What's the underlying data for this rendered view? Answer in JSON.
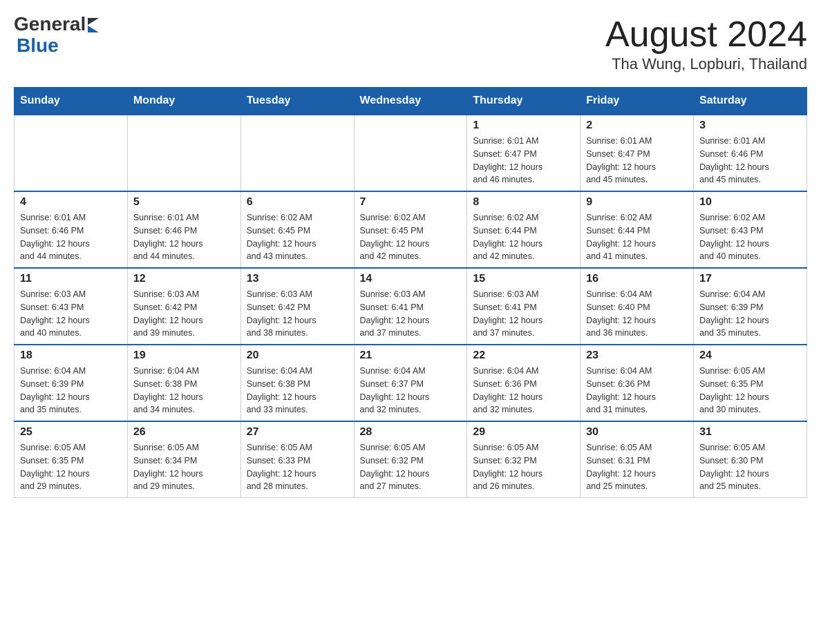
{
  "header": {
    "logo": {
      "general": "General",
      "arrow": "▶",
      "blue": "Blue"
    },
    "title": "August 2024",
    "subtitle": "Tha Wung, Lopburi, Thailand"
  },
  "weekdays": [
    "Sunday",
    "Monday",
    "Tuesday",
    "Wednesday",
    "Thursday",
    "Friday",
    "Saturday"
  ],
  "weeks": [
    [
      {
        "day": "",
        "info": ""
      },
      {
        "day": "",
        "info": ""
      },
      {
        "day": "",
        "info": ""
      },
      {
        "day": "",
        "info": ""
      },
      {
        "day": "1",
        "info": "Sunrise: 6:01 AM\nSunset: 6:47 PM\nDaylight: 12 hours\nand 46 minutes."
      },
      {
        "day": "2",
        "info": "Sunrise: 6:01 AM\nSunset: 6:47 PM\nDaylight: 12 hours\nand 45 minutes."
      },
      {
        "day": "3",
        "info": "Sunrise: 6:01 AM\nSunset: 6:46 PM\nDaylight: 12 hours\nand 45 minutes."
      }
    ],
    [
      {
        "day": "4",
        "info": "Sunrise: 6:01 AM\nSunset: 6:46 PM\nDaylight: 12 hours\nand 44 minutes."
      },
      {
        "day": "5",
        "info": "Sunrise: 6:01 AM\nSunset: 6:46 PM\nDaylight: 12 hours\nand 44 minutes."
      },
      {
        "day": "6",
        "info": "Sunrise: 6:02 AM\nSunset: 6:45 PM\nDaylight: 12 hours\nand 43 minutes."
      },
      {
        "day": "7",
        "info": "Sunrise: 6:02 AM\nSunset: 6:45 PM\nDaylight: 12 hours\nand 42 minutes."
      },
      {
        "day": "8",
        "info": "Sunrise: 6:02 AM\nSunset: 6:44 PM\nDaylight: 12 hours\nand 42 minutes."
      },
      {
        "day": "9",
        "info": "Sunrise: 6:02 AM\nSunset: 6:44 PM\nDaylight: 12 hours\nand 41 minutes."
      },
      {
        "day": "10",
        "info": "Sunrise: 6:02 AM\nSunset: 6:43 PM\nDaylight: 12 hours\nand 40 minutes."
      }
    ],
    [
      {
        "day": "11",
        "info": "Sunrise: 6:03 AM\nSunset: 6:43 PM\nDaylight: 12 hours\nand 40 minutes."
      },
      {
        "day": "12",
        "info": "Sunrise: 6:03 AM\nSunset: 6:42 PM\nDaylight: 12 hours\nand 39 minutes."
      },
      {
        "day": "13",
        "info": "Sunrise: 6:03 AM\nSunset: 6:42 PM\nDaylight: 12 hours\nand 38 minutes."
      },
      {
        "day": "14",
        "info": "Sunrise: 6:03 AM\nSunset: 6:41 PM\nDaylight: 12 hours\nand 37 minutes."
      },
      {
        "day": "15",
        "info": "Sunrise: 6:03 AM\nSunset: 6:41 PM\nDaylight: 12 hours\nand 37 minutes."
      },
      {
        "day": "16",
        "info": "Sunrise: 6:04 AM\nSunset: 6:40 PM\nDaylight: 12 hours\nand 36 minutes."
      },
      {
        "day": "17",
        "info": "Sunrise: 6:04 AM\nSunset: 6:39 PM\nDaylight: 12 hours\nand 35 minutes."
      }
    ],
    [
      {
        "day": "18",
        "info": "Sunrise: 6:04 AM\nSunset: 6:39 PM\nDaylight: 12 hours\nand 35 minutes."
      },
      {
        "day": "19",
        "info": "Sunrise: 6:04 AM\nSunset: 6:38 PM\nDaylight: 12 hours\nand 34 minutes."
      },
      {
        "day": "20",
        "info": "Sunrise: 6:04 AM\nSunset: 6:38 PM\nDaylight: 12 hours\nand 33 minutes."
      },
      {
        "day": "21",
        "info": "Sunrise: 6:04 AM\nSunset: 6:37 PM\nDaylight: 12 hours\nand 32 minutes."
      },
      {
        "day": "22",
        "info": "Sunrise: 6:04 AM\nSunset: 6:36 PM\nDaylight: 12 hours\nand 32 minutes."
      },
      {
        "day": "23",
        "info": "Sunrise: 6:04 AM\nSunset: 6:36 PM\nDaylight: 12 hours\nand 31 minutes."
      },
      {
        "day": "24",
        "info": "Sunrise: 6:05 AM\nSunset: 6:35 PM\nDaylight: 12 hours\nand 30 minutes."
      }
    ],
    [
      {
        "day": "25",
        "info": "Sunrise: 6:05 AM\nSunset: 6:35 PM\nDaylight: 12 hours\nand 29 minutes."
      },
      {
        "day": "26",
        "info": "Sunrise: 6:05 AM\nSunset: 6:34 PM\nDaylight: 12 hours\nand 29 minutes."
      },
      {
        "day": "27",
        "info": "Sunrise: 6:05 AM\nSunset: 6:33 PM\nDaylight: 12 hours\nand 28 minutes."
      },
      {
        "day": "28",
        "info": "Sunrise: 6:05 AM\nSunset: 6:32 PM\nDaylight: 12 hours\nand 27 minutes."
      },
      {
        "day": "29",
        "info": "Sunrise: 6:05 AM\nSunset: 6:32 PM\nDaylight: 12 hours\nand 26 minutes."
      },
      {
        "day": "30",
        "info": "Sunrise: 6:05 AM\nSunset: 6:31 PM\nDaylight: 12 hours\nand 25 minutes."
      },
      {
        "day": "31",
        "info": "Sunrise: 6:05 AM\nSunset: 6:30 PM\nDaylight: 12 hours\nand 25 minutes."
      }
    ]
  ]
}
